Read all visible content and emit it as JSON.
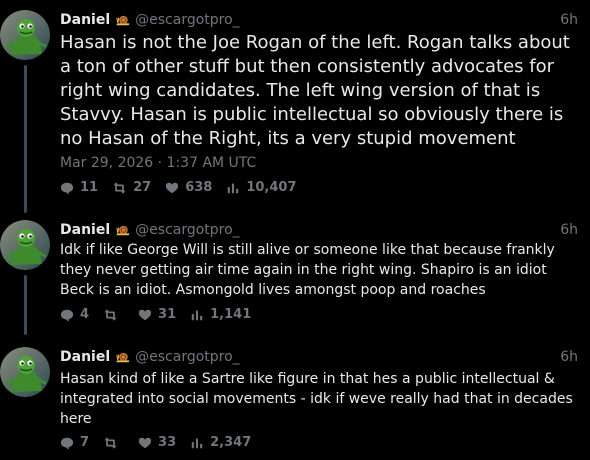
{
  "thread": {
    "colors": {
      "background": "#000000",
      "text": "#e7e9ea",
      "muted": "#71767b",
      "thread_line": "#3a4a57"
    },
    "posts": [
      {
        "author_name": "Daniel",
        "author_handle": "@escargotpro_",
        "badge_icon": "snail-icon",
        "time_ago": "6h",
        "text": "Hasan is not the Joe Rogan of the left. Rogan talks about a ton of other stuff but then consistently advocates for right wing candidates. The left wing version of that is Stavvy. Hasan is public intellectual so obviously there is no Hasan of the Right, its a very stupid movement",
        "date": "Mar 29, 2026 · 1:37 AM UTC",
        "replies": "11",
        "reposts": "27",
        "likes": "638",
        "views": "10,407"
      },
      {
        "author_name": "Daniel",
        "author_handle": "@escargotpro_",
        "badge_icon": "snail-icon",
        "time_ago": "6h",
        "text": "Idk if like George Will is still alive or someone like that because frankly they never getting air time again in the right wing. Shapiro is an idiot Beck is an idiot. Asmongold lives amongst poop and roaches",
        "replies": "4",
        "reposts": "",
        "likes": "31",
        "views": "1,141"
      },
      {
        "author_name": "Daniel",
        "author_handle": "@escargotpro_",
        "badge_icon": "snail-icon",
        "time_ago": "6h",
        "text": "Hasan kind of like a Sartre like figure in that hes a public intellectual & integrated into social movements - idk if weve really had that in decades here",
        "replies": "7",
        "reposts": "",
        "likes": "33",
        "views": "2,347"
      }
    ]
  }
}
